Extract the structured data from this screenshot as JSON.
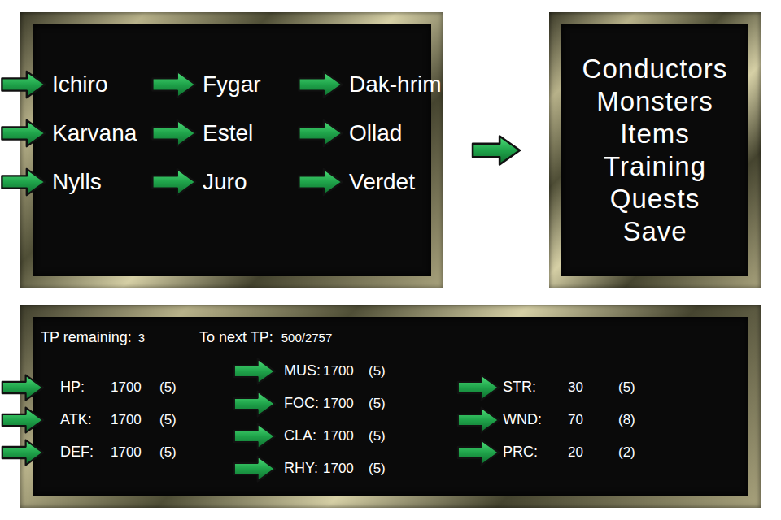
{
  "conductors": [
    {
      "name": "Ichiro"
    },
    {
      "name": "Fygar"
    },
    {
      "name": "Dak-hrim"
    },
    {
      "name": "Karvana"
    },
    {
      "name": "Estel"
    },
    {
      "name": "Ollad"
    },
    {
      "name": "Nylls"
    },
    {
      "name": "Juro"
    },
    {
      "name": "Verdet"
    }
  ],
  "menu": {
    "items": [
      "Conductors",
      "Monsters",
      "Items",
      "Training",
      "Quests",
      "Save"
    ]
  },
  "stats": {
    "tp_remaining_label": "TP remaining:",
    "tp_remaining": "3",
    "next_tp_label": "To next TP:",
    "next_tp": "500/2757",
    "columns": [
      [
        {
          "label": "HP:",
          "value": "1700",
          "cost": "(5)"
        },
        {
          "label": "ATK:",
          "value": "1700",
          "cost": "(5)"
        },
        {
          "label": "DEF:",
          "value": "1700",
          "cost": "(5)"
        }
      ],
      [
        {
          "label": "MUS:",
          "value": "1700",
          "cost": "(5)"
        },
        {
          "label": "FOC:",
          "value": "1700",
          "cost": "(5)"
        },
        {
          "label": "CLA:",
          "value": "1700",
          "cost": "(5)"
        },
        {
          "label": "RHY:",
          "value": "1700",
          "cost": "(5)"
        }
      ],
      [
        {
          "label": "STR:",
          "value": "30",
          "cost": "(5)"
        },
        {
          "label": "WND:",
          "value": "70",
          "cost": "(8)"
        },
        {
          "label": "PRC:",
          "value": "20",
          "cost": "(2)"
        }
      ]
    ]
  }
}
